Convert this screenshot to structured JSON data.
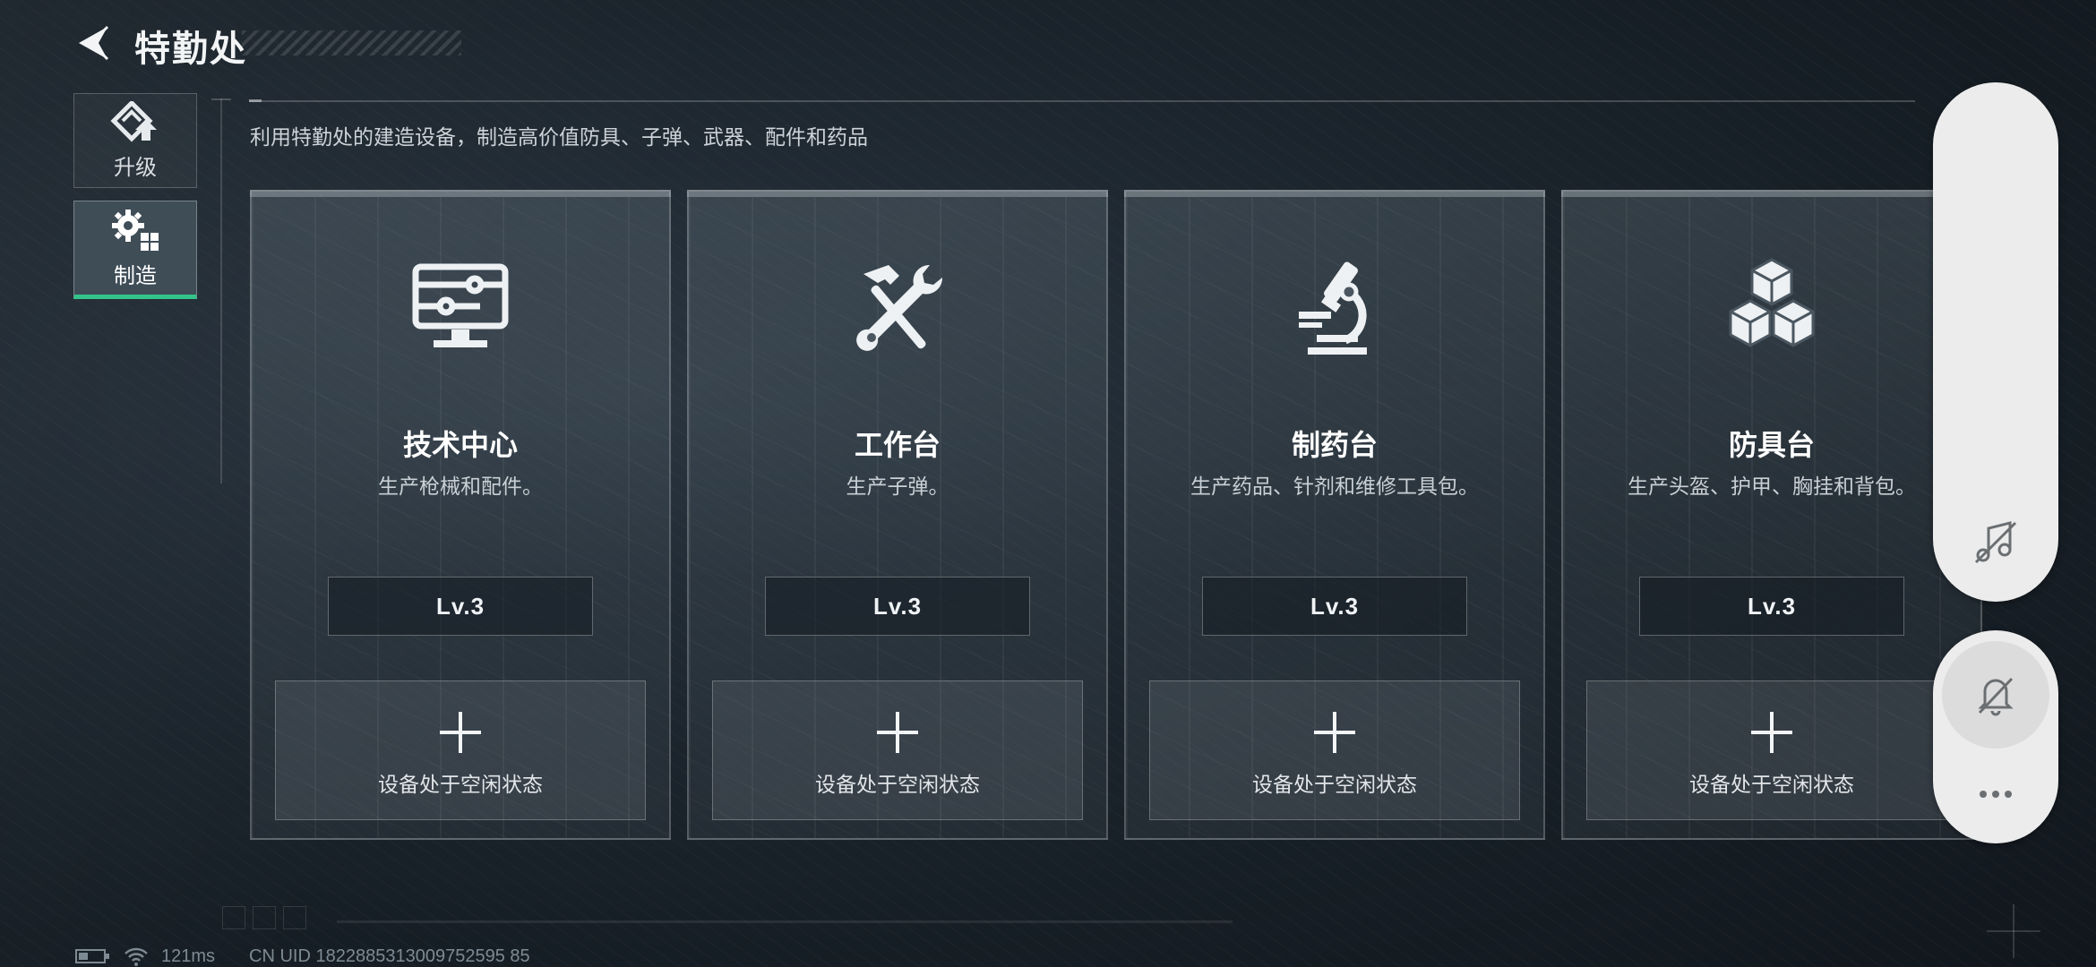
{
  "header": {
    "title": "特勤处"
  },
  "tabs": [
    {
      "label": "升级",
      "icon": "upgrade-icon",
      "active": false
    },
    {
      "label": "制造",
      "icon": "gear-blocks-icon",
      "active": true
    }
  ],
  "description": "利用特勤处的建造设备，制造高价值防具、子弹、武器、配件和药品",
  "stations": [
    {
      "name": "技术中心",
      "desc": "生产枪械和配件。",
      "level": "Lv.3",
      "icon": "monitor-circuit-icon",
      "slot_text": "设备处于空闲状态"
    },
    {
      "name": "工作台",
      "desc": "生产子弹。",
      "level": "Lv.3",
      "icon": "hammer-wrench-icon",
      "slot_text": "设备处于空闲状态"
    },
    {
      "name": "制药台",
      "desc": "生产药品、针剂和维修工具包。",
      "level": "Lv.3",
      "icon": "microscope-icon",
      "slot_text": "设备处于空闲状态"
    },
    {
      "name": "防具台",
      "desc": "生产头盔、护甲、胸挂和背包。",
      "level": "Lv.3",
      "icon": "stacked-cubes-icon",
      "slot_text": "设备处于空闲状态"
    }
  ],
  "floating": {
    "music_icon": "music-off-icon",
    "bell_icon": "bell-off-icon",
    "more_icon": "more-icon"
  },
  "status": {
    "ping": "121ms",
    "uid": "CN UID 1822885313009752595 85"
  },
  "colors": {
    "accent": "#33c48a",
    "panel": "#ececec"
  }
}
